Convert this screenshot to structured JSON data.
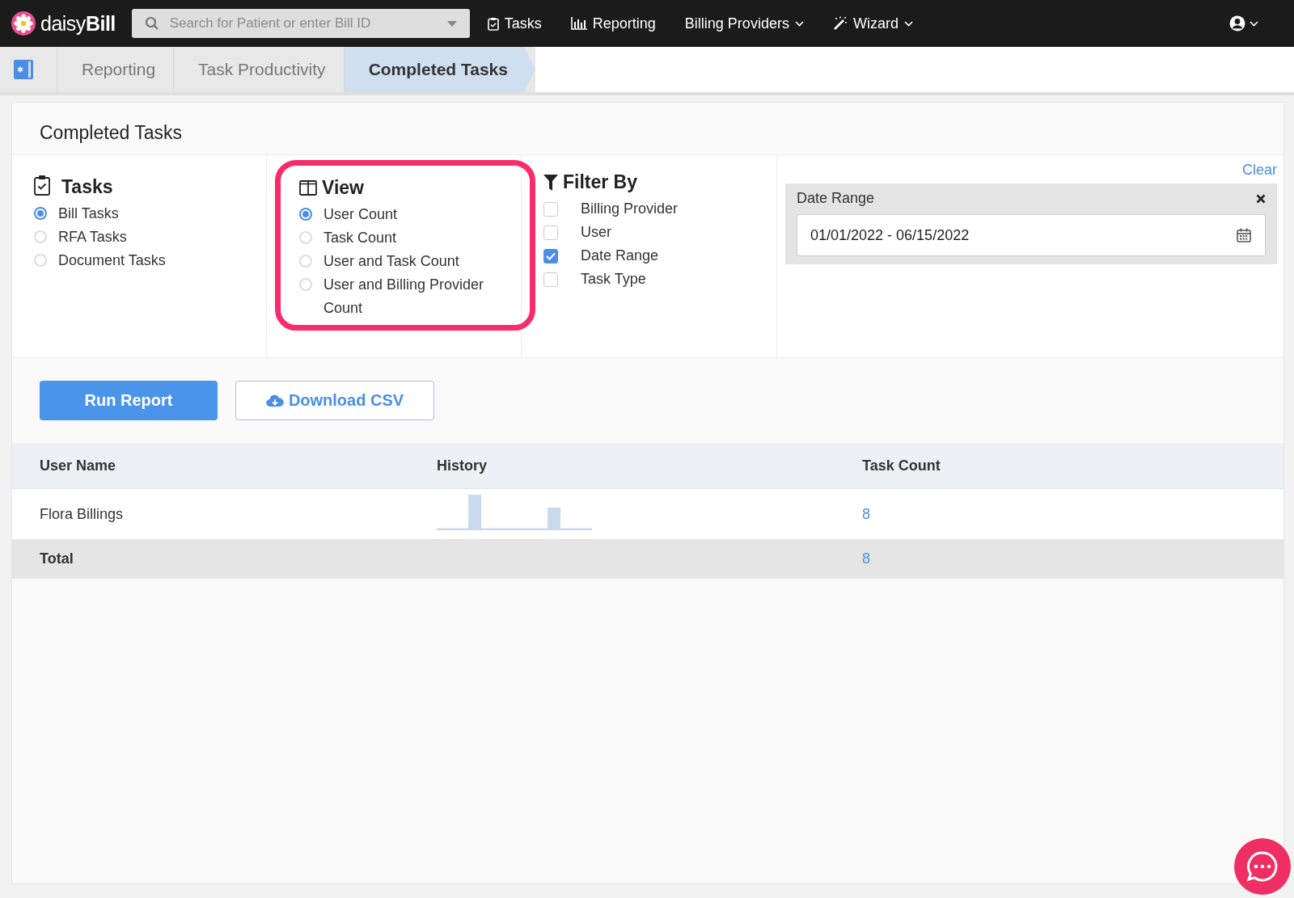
{
  "navbar": {
    "brand_prefix": "daisy",
    "brand_suffix": "Bill",
    "search": {
      "placeholder": "Search for Patient or enter Bill ID"
    },
    "items": [
      {
        "label": "Tasks",
        "dropdown": false
      },
      {
        "label": "Reporting",
        "dropdown": false
      },
      {
        "label": "Billing Providers",
        "dropdown": true
      },
      {
        "label": "Wizard",
        "dropdown": true
      }
    ]
  },
  "breadcrumbs": [
    {
      "label": "Reporting",
      "selected": false
    },
    {
      "label": "Task Productivity",
      "selected": false
    },
    {
      "label": "Completed Tasks",
      "selected": true
    }
  ],
  "page_title": "Completed Tasks",
  "tasks": {
    "title": "Tasks",
    "options": [
      {
        "label": "Bill Tasks",
        "selected": true
      },
      {
        "label": "RFA Tasks",
        "selected": false
      },
      {
        "label": "Document Tasks",
        "selected": false
      }
    ]
  },
  "view": {
    "title": "View",
    "highlighted": true,
    "options": [
      {
        "label": "User Count",
        "selected": true
      },
      {
        "label": "Task Count",
        "selected": false
      },
      {
        "label": "User and Task Count",
        "selected": false
      },
      {
        "label": "User and Billing Provider Count",
        "selected": false
      }
    ]
  },
  "filter_by": {
    "title": "Filter By",
    "options": [
      {
        "label": "Billing Provider",
        "checked": false
      },
      {
        "label": "User",
        "checked": false
      },
      {
        "label": "Date Range",
        "checked": true
      },
      {
        "label": "Task Type",
        "checked": false
      }
    ]
  },
  "filters_panel": {
    "clear": "Clear",
    "date_range": {
      "label": "Date Range",
      "value": "01/01/2022 - 06/15/2022"
    }
  },
  "buttons": {
    "run": "Run Report",
    "download": "Download CSV"
  },
  "table": {
    "columns": [
      "User Name",
      "History",
      "Task Count"
    ],
    "rows": [
      {
        "user": "Flora Billings",
        "count": "8"
      }
    ],
    "total": {
      "label": "Total",
      "count": "8"
    }
  }
}
